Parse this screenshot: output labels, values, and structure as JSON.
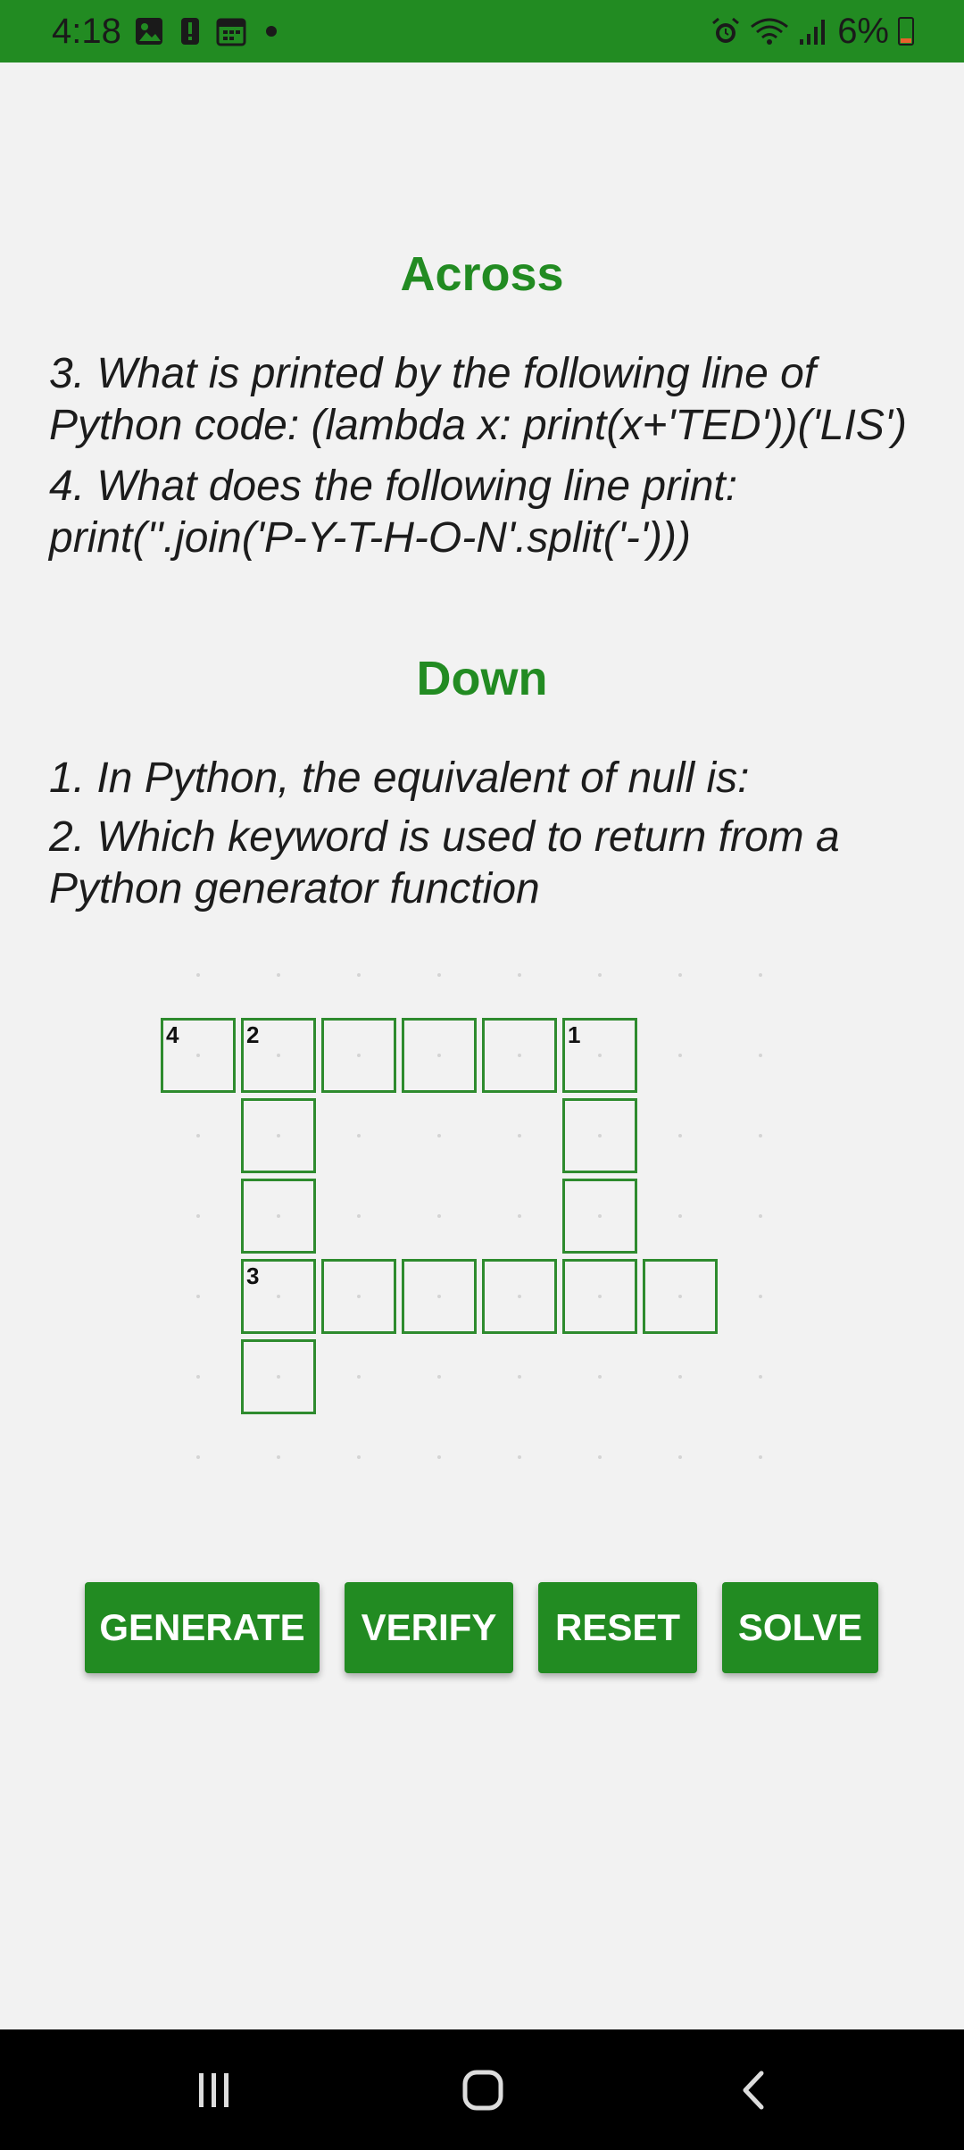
{
  "status_bar": {
    "time": "4:18",
    "battery": "6%",
    "left_icons": [
      "image-icon",
      "alert-icon",
      "calendar-icon",
      "dot-icon"
    ],
    "right_icons": [
      "alarm-icon",
      "wifi-icon",
      "signal-icon",
      "battery-icon"
    ]
  },
  "across": {
    "heading": "Across",
    "clues": [
      "3. What is printed by the following line of\nPython code:  (lambda x: print(x+'TED'))('LIS')",
      "4. What does the following line print:\nprint(''.join('P-Y-T-H-O-N'.split('-')))"
    ]
  },
  "down": {
    "heading": "Down",
    "clues": [
      "1. In Python, the equivalent of null is:",
      "2. Which keyword is used to return from a\nPython generator function"
    ]
  },
  "grid": {
    "numbers": [
      "4",
      "2",
      "1",
      "3"
    ]
  },
  "buttons": {
    "generate": "GENERATE",
    "verify": "VERIFY",
    "reset": "RESET",
    "solve": "SOLVE"
  },
  "nav": [
    "recents-icon",
    "home-icon",
    "back-icon"
  ],
  "colors": {
    "accent": "#228b22",
    "background": "#f2f2f2",
    "cell_border": "#2e8b2e",
    "navbar": "#000000"
  }
}
